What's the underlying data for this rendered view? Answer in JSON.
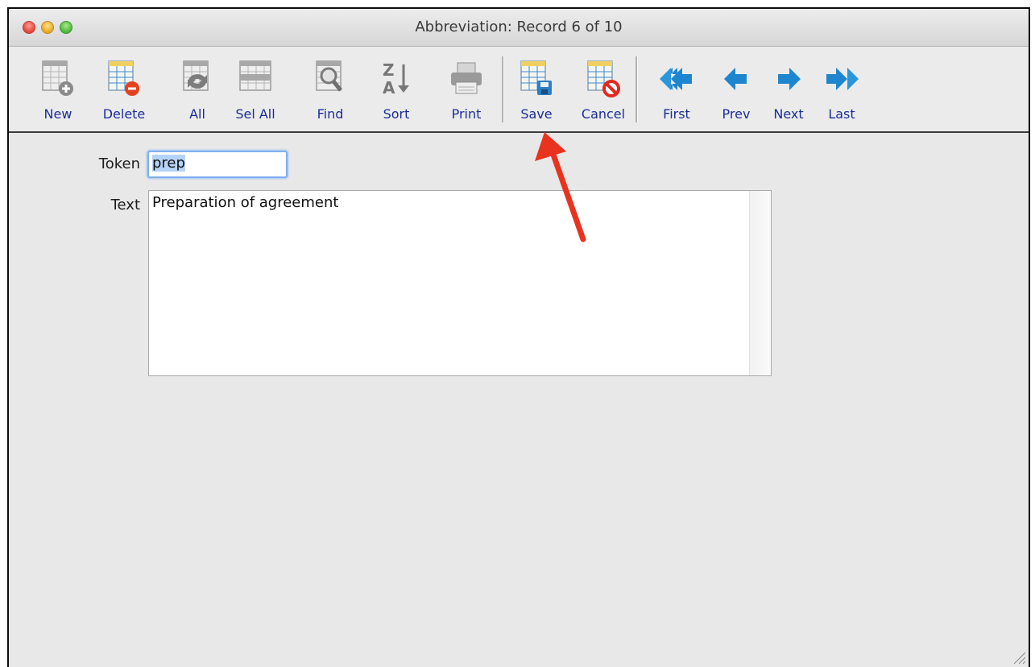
{
  "window": {
    "title": "Abbreviation: Record 6 of 10"
  },
  "toolbar": {
    "buttons": [
      {
        "label": "New",
        "icon": "table-add-icon"
      },
      {
        "label": "Delete",
        "icon": "table-delete-icon"
      },
      {
        "label": "All",
        "icon": "table-refresh-icon"
      },
      {
        "label": "Sel All",
        "icon": "table-select-all-icon"
      },
      {
        "label": "Find",
        "icon": "table-find-icon"
      },
      {
        "label": "Sort",
        "icon": "sort-za-icon"
      },
      {
        "label": "Print",
        "icon": "printer-icon"
      },
      {
        "label": "Save",
        "icon": "table-save-icon"
      },
      {
        "label": "Cancel",
        "icon": "table-cancel-icon"
      },
      {
        "label": "First",
        "icon": "first-arrow-icon"
      },
      {
        "label": "Prev",
        "icon": "prev-arrow-icon"
      },
      {
        "label": "Next",
        "icon": "next-arrow-icon"
      },
      {
        "label": "Last",
        "icon": "last-arrow-icon"
      }
    ]
  },
  "form": {
    "token_label": "Token",
    "token_value": "prep",
    "text_label": "Text",
    "text_value": "Preparation of agreement"
  },
  "colors": {
    "label_blue": "#1b2d98",
    "arrow_red": "#e8331f",
    "nav_blue": "#1e86cf"
  }
}
